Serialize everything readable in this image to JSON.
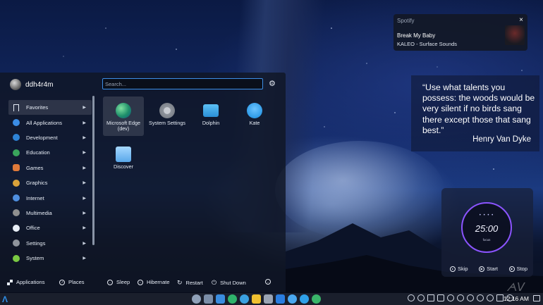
{
  "spotify": {
    "app_name": "Spotify",
    "close_glyph": "×",
    "track": "Break My Baby",
    "artist_album": "KALEO - Surface Sounds"
  },
  "quote": {
    "text": "“Use what talents you possess: the woods would be very silent if no birds sang there except those that sang best.”",
    "author": "Henry Van Dyke"
  },
  "timer": {
    "dots": "• • • •",
    "time": "25:00",
    "mode": "focus",
    "skip": "Skip",
    "start": "Start",
    "stop": "Stop"
  },
  "launcher": {
    "username": "ddh4r4m",
    "search_placeholder": "Search...",
    "categories": [
      {
        "label": "Favorites",
        "color": "transparent"
      },
      {
        "label": "All Applications",
        "color": "#3b8de6"
      },
      {
        "label": "Development",
        "color": "#2e83d6"
      },
      {
        "label": "Education",
        "color": "#3aa55c"
      },
      {
        "label": "Games",
        "color": "#e07a3a"
      },
      {
        "label": "Graphics",
        "color": "#d9a23a"
      },
      {
        "label": "Internet",
        "color": "#4f8fe0"
      },
      {
        "label": "Multimedia",
        "color": "#8f8f8f"
      },
      {
        "label": "Office",
        "color": "#e8eef6"
      },
      {
        "label": "Settings",
        "color": "#8f949c"
      },
      {
        "label": "System",
        "color": "#7ac943"
      }
    ],
    "apps": [
      {
        "label": "Microsoft Edge (dev)",
        "color": "#1f8f6a"
      },
      {
        "label": "System Settings",
        "color": "#8f949c"
      },
      {
        "label": "Dolphin",
        "color": "#3aa0e0"
      },
      {
        "label": "Kate",
        "color": "#2f9be8"
      },
      {
        "label": "Discover",
        "color": "#6fb8f0"
      }
    ],
    "footer": {
      "applications": "Applications",
      "places": "Places",
      "sleep": "Sleep",
      "hibernate": "Hibernate",
      "restart": "Restart",
      "shutdown": "Shut Down"
    }
  },
  "taskbar": {
    "logo_glyph": "Λ",
    "apps": [
      "#8fa0b8",
      "#7b8ea8",
      "#3a8de0",
      "#2fb36b",
      "#3aa0e0",
      "#f0c030",
      "#9aa4b4",
      "#2a7de0",
      "#4aa8f0",
      "#2fa0e8",
      "#3ab56a"
    ],
    "clock": "12:16 AM"
  }
}
